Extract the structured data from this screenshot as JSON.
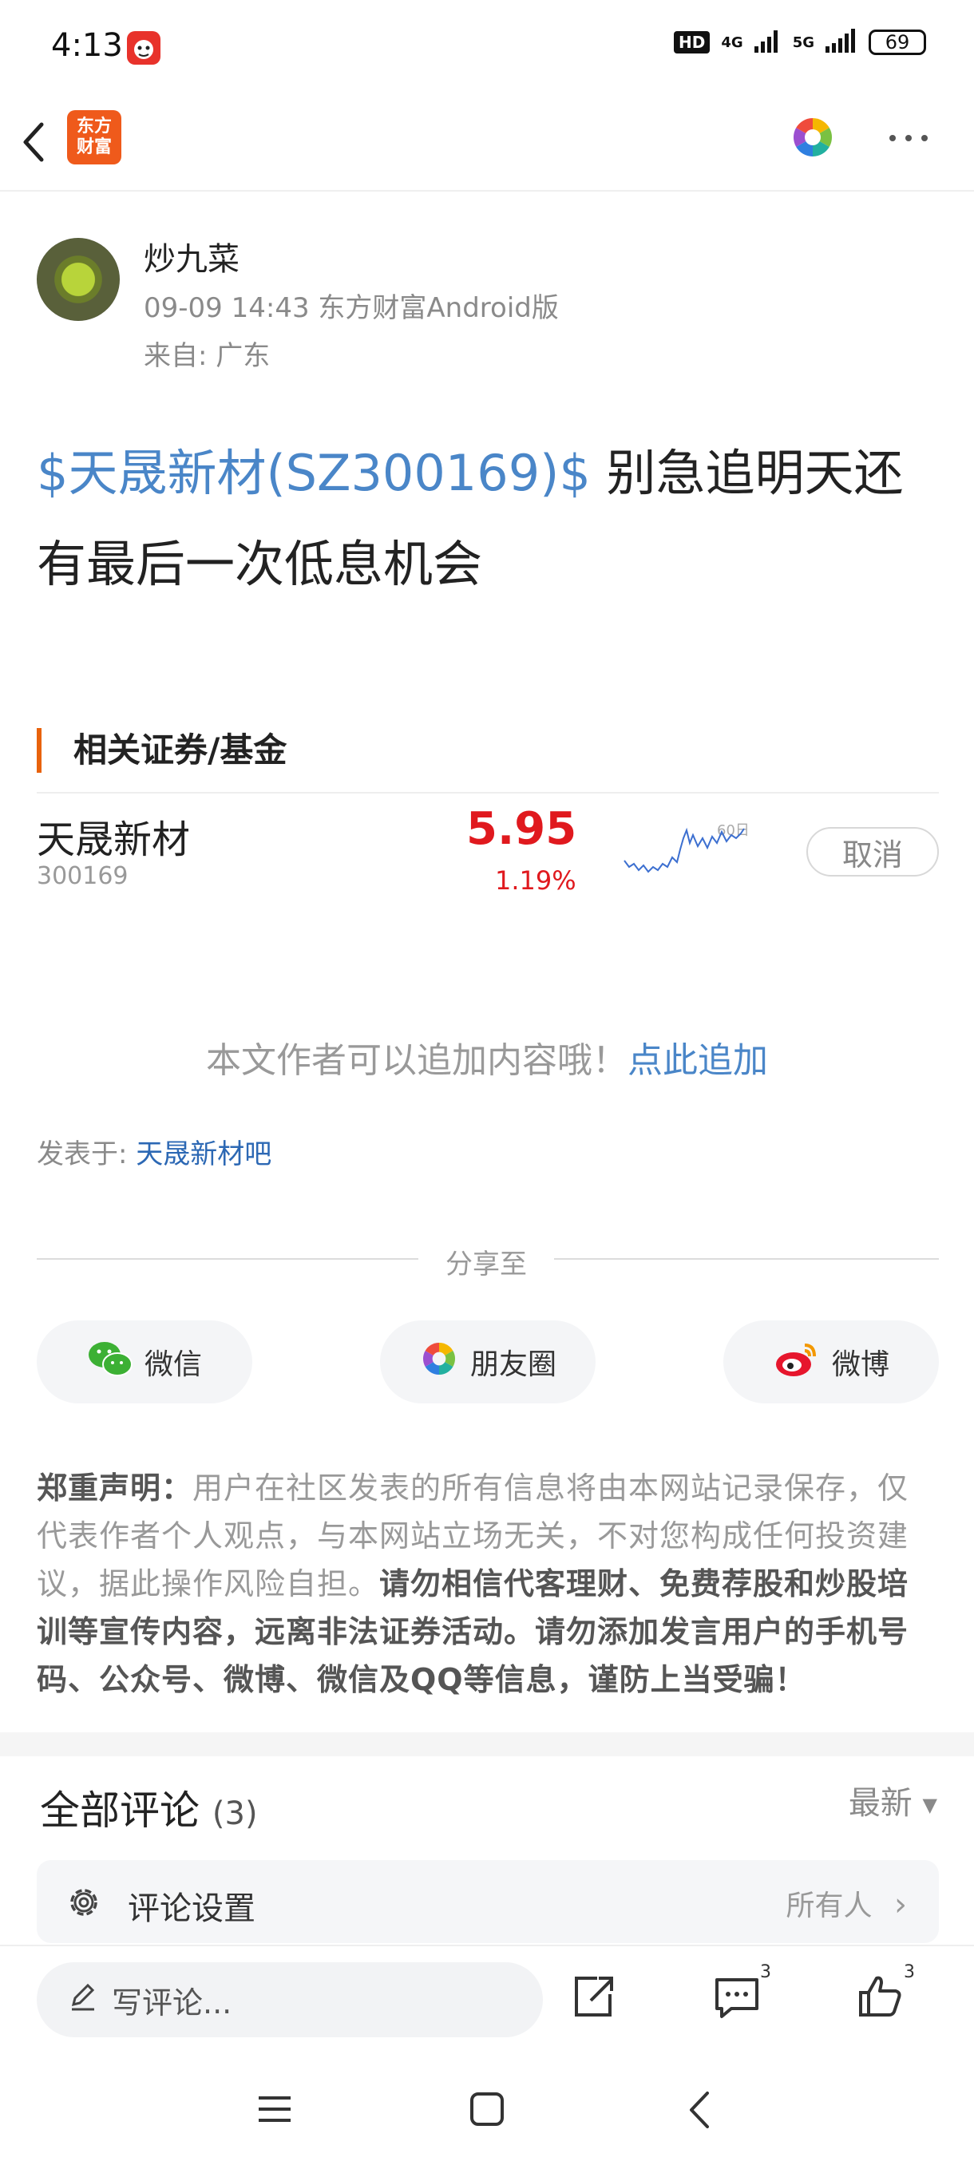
{
  "status_bar": {
    "time": "4:13",
    "hd": "HD",
    "net1": "4G",
    "net2": "5G",
    "battery": "69"
  },
  "nav": {
    "logo_line1": "东方",
    "logo_line2": "财富",
    "brand_color": "#ef5a1b"
  },
  "post": {
    "author": "炒九菜",
    "meta": "09-09 14:43 东方财富Android版",
    "location": "来自: 广东",
    "stock_tag": "$天晟新材(SZ300169)$",
    "text": " 别急追明天还有最后一次低息机会"
  },
  "related": {
    "heading": "相关证券/基金",
    "stock": {
      "name": "天晟新材",
      "code": "300169",
      "price": "5.95",
      "change": "1.19%",
      "chart_label": "60日",
      "cancel_label": "取消"
    }
  },
  "append": {
    "text": "本文作者可以追加内容哦！",
    "link": "点此追加"
  },
  "posted_in": {
    "label": "发表于: ",
    "link": "天晟新材吧"
  },
  "share": {
    "label": "分享至",
    "wechat": "微信",
    "moments": "朋友圈",
    "weibo": "微博"
  },
  "disclaimer": {
    "title": "郑重声明：",
    "body": "用户在社区发表的所有信息将由本网站记录保存，仅代表作者个人观点，与本网站立场无关，不对您构成任何投资建议，据此操作风险自担。",
    "bold": "请勿相信代客理财、免费荐股和炒股培训等宣传内容，远离非法证券活动。请勿添加发言用户的手机号码、公众号、微博、微信及QQ等信息，谨防上当受骗！"
  },
  "comments": {
    "title": "全部评论",
    "count": "(3)",
    "sort": "最新",
    "settings_label": "评论设置",
    "settings_value": "所有人"
  },
  "bottom_bar": {
    "write_placeholder": "写评论...",
    "comment_count": "3",
    "like_count": "3"
  },
  "colors": {
    "link_blue": "#4a86c8",
    "price_red": "#e0191e",
    "accent_orange": "#e8620c"
  }
}
